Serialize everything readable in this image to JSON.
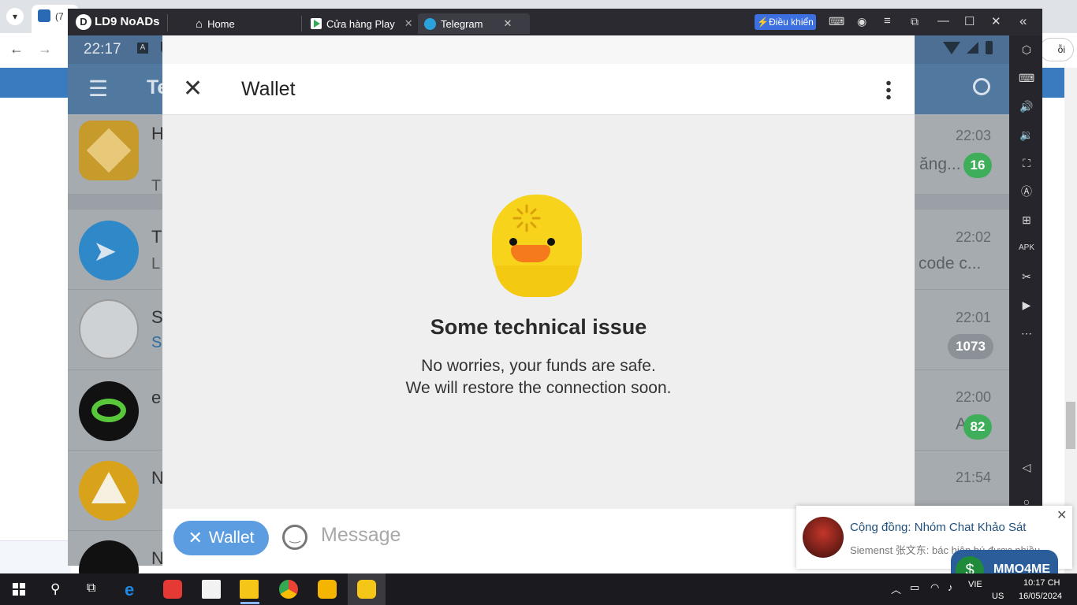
{
  "browser": {
    "tab_title": "(7",
    "button_label_partial": "ỗi"
  },
  "emulator": {
    "app_name": "LD9 NoADs",
    "tabs": [
      {
        "label": "Home"
      },
      {
        "label": "Cửa hàng Play"
      },
      {
        "label": "Telegram"
      }
    ],
    "control_button": "Điều khiển"
  },
  "android": {
    "clock": "22:17"
  },
  "telegram": {
    "title_partial": "Te",
    "chats": [
      {
        "name": "H",
        "preview": "T",
        "preview_right": "ăng...",
        "time": "22:03",
        "badge": "16",
        "badge_color": "#3fae5a"
      },
      {
        "name": "T",
        "preview": "L",
        "preview_right": "code c...",
        "time": "22:02",
        "badge": "",
        "badge_color": ""
      },
      {
        "name": "S",
        "preview": "S",
        "preview_right": "",
        "time": "22:01",
        "badge": "1073",
        "badge_color": "#9aa0a6"
      },
      {
        "name": "e",
        "preview": "",
        "preview_right": "Ai...",
        "time": "22:00",
        "badge": "82",
        "badge_color": "#3fae5a"
      },
      {
        "name": "N",
        "preview": "",
        "preview_right": "",
        "time": "21:54",
        "badge": "",
        "badge_color": ""
      },
      {
        "name": "N",
        "preview": "",
        "preview_right": "",
        "time": "",
        "badge": "",
        "badge_color": ""
      }
    ]
  },
  "wallet": {
    "title": "Wallet",
    "error_title": "Some technical issue",
    "line1": "No worries, your funds are safe.",
    "line2": "We will restore the connection soon.",
    "bottom_button": "Wallet",
    "message_placeholder": "Message"
  },
  "notification": {
    "title": "Cộng đồng: Nhóm Chat Khảo Sát",
    "body": "Siemenst 张文东: bác hiện bú được nhiều ...",
    "brand": "MMO4ME"
  },
  "taskbar": {
    "time": "10:17 CH",
    "date": "16/05/2024",
    "lang": "VIE",
    "region": "US"
  },
  "colors": {
    "telegram_header": "#51789f",
    "wallet_accent": "#5b9de0",
    "badge_green": "#3fae5a"
  }
}
